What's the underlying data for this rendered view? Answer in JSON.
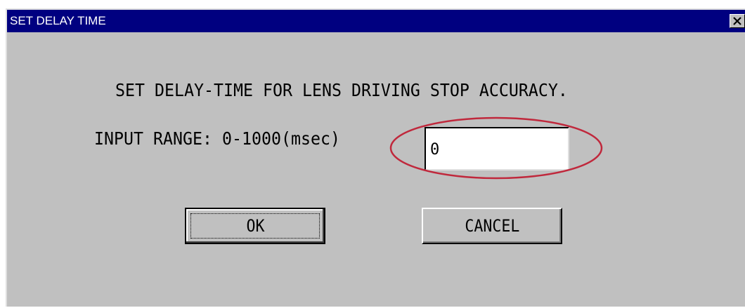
{
  "window": {
    "title": "SET DELAY TIME",
    "close_icon": "close-icon"
  },
  "dialog": {
    "message": "SET DELAY-TIME FOR LENS DRIVING STOP ACCURACY.",
    "range_label": "INPUT RANGE:  0-1000(msec)",
    "delay_value": "0",
    "ok_label": "OK",
    "cancel_label": "CANCEL"
  },
  "colors": {
    "titlebar": "#000080",
    "face": "#c0c0c0",
    "highlight_ring": "#c0283c"
  }
}
